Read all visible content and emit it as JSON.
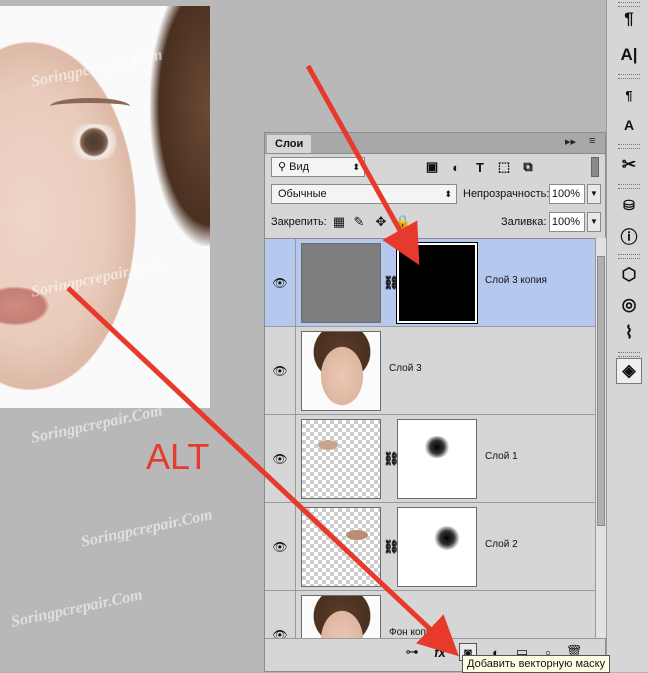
{
  "annotation": {
    "alt_label": "ALT",
    "arrow_color": "#e8392d"
  },
  "watermark": "Soringpcrepair.Com",
  "right_toolbar": {
    "items": [
      {
        "name": "paragraph-icon",
        "glyph": "¶"
      },
      {
        "name": "character-icon",
        "glyph": "A|"
      },
      {
        "name": "paragraph-styles-icon",
        "glyph": "¶"
      },
      {
        "name": "character-styles-icon",
        "glyph": "A"
      },
      {
        "name": "tools-preset-icon",
        "glyph": "✂"
      },
      {
        "name": "3d-icon",
        "glyph": "⛁"
      },
      {
        "name": "info-icon",
        "glyph": "ⓘ"
      },
      {
        "name": "cube-icon",
        "glyph": "⬡"
      },
      {
        "name": "channels-icon",
        "glyph": "◎"
      },
      {
        "name": "paths-icon",
        "glyph": "⌇"
      },
      {
        "name": "layers-icon",
        "glyph": "◈"
      }
    ]
  },
  "layers_panel": {
    "tab_label": "Слои",
    "collapse_glyph": "▸▸",
    "menu_glyph": "≡",
    "filter": {
      "value": "Вид",
      "search_glyph": "⚲"
    },
    "filter_icons": [
      "▣",
      "◐",
      "T",
      "⬚",
      "⧉"
    ],
    "blend_mode": "Обычные",
    "opacity_label": "Непрозрачность:",
    "opacity_value": "100%",
    "lock_label": "Закрепить:",
    "lock_icons": [
      "▦",
      "✎",
      "✥",
      "🔒"
    ],
    "fill_label": "Заливка:",
    "fill_value": "100%",
    "layers": [
      {
        "name": "Слой 3 копия",
        "selected": true,
        "thumb": "gray",
        "mask": "black"
      },
      {
        "name": "Слой 3",
        "selected": false,
        "thumb": "face",
        "mask": null
      },
      {
        "name": "Слой 1",
        "selected": false,
        "thumb": "checker",
        "mask": "white"
      },
      {
        "name": "Слой 2",
        "selected": false,
        "thumb": "checker",
        "mask": "white"
      },
      {
        "name": "Фон копия",
        "selected": false,
        "thumb": "face",
        "mask": null
      }
    ],
    "footer_icons": [
      "⊶",
      "fx",
      "◙",
      "◐",
      "▭",
      "▫",
      "🗑"
    ],
    "tooltip": "Добавить векторную маску"
  }
}
